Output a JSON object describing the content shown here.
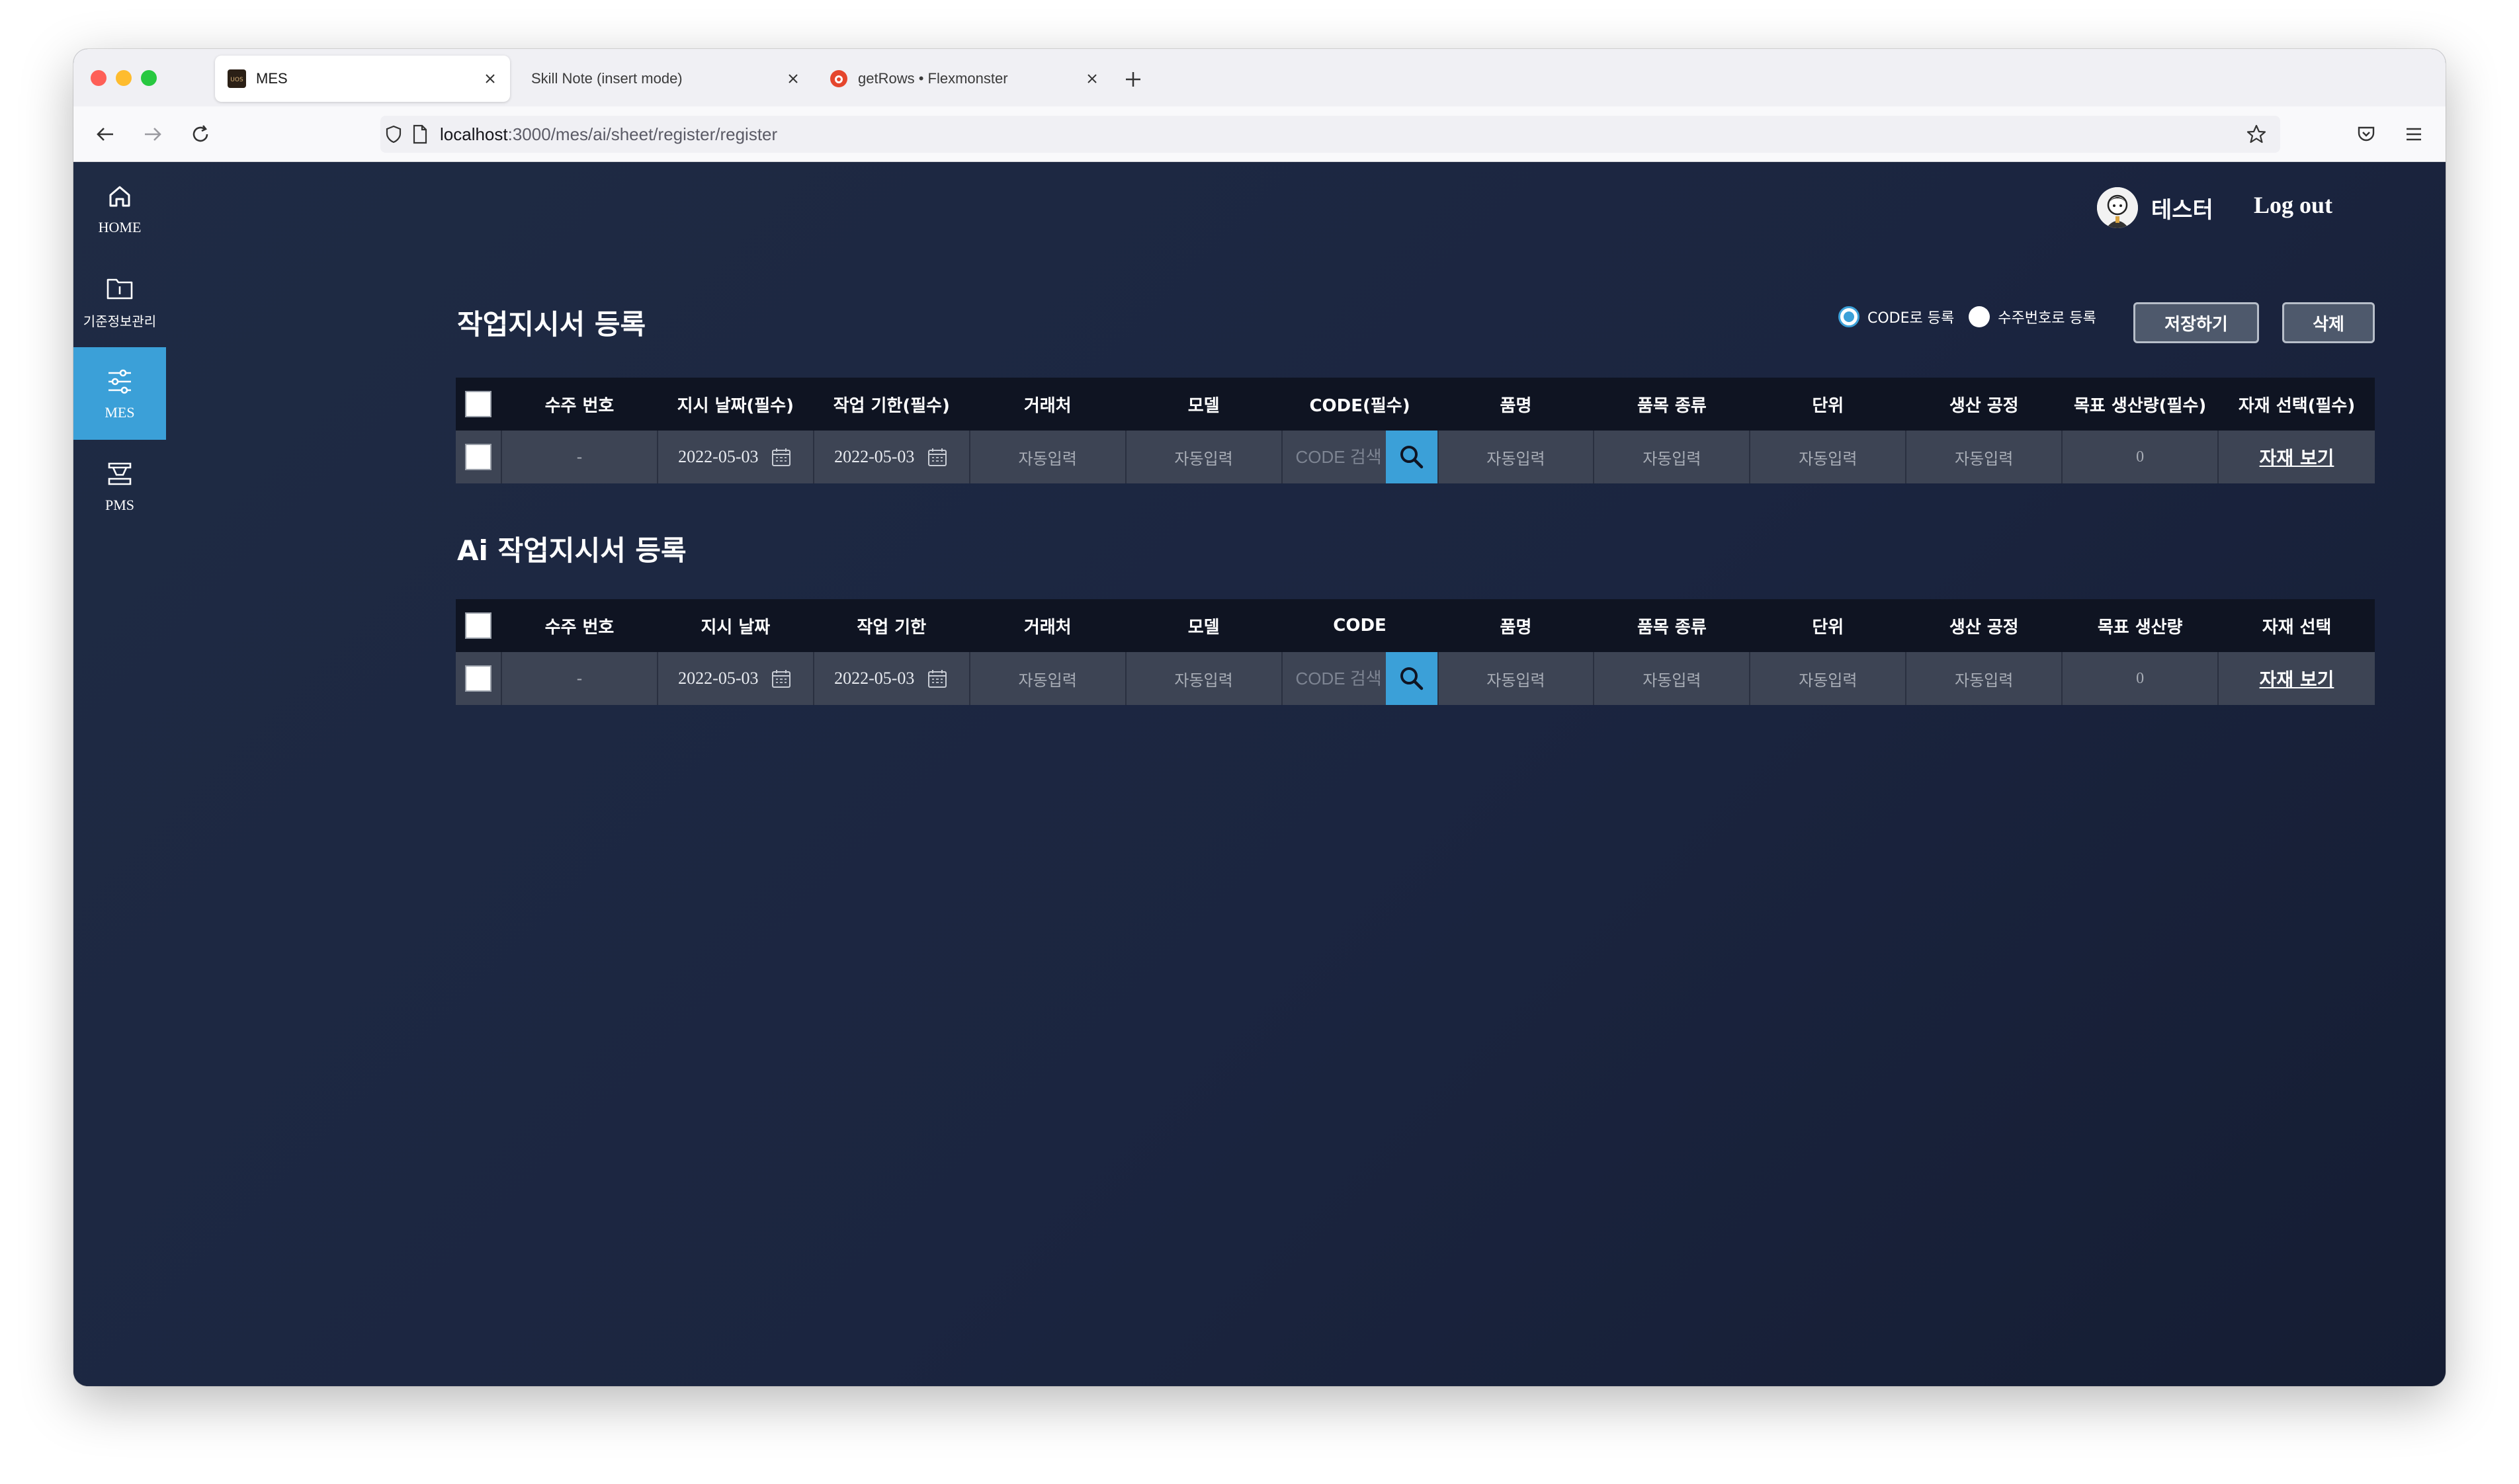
{
  "browser": {
    "tabs": [
      {
        "label": "MES",
        "active": true
      },
      {
        "label": "Skill Note (insert mode)",
        "active": false
      },
      {
        "label": "getRows • Flexmonster",
        "active": false
      }
    ],
    "url_host": "localhost",
    "url_path": ":3000/mes/ai/sheet/register/register"
  },
  "sidebar": {
    "items": [
      {
        "label": "HOME",
        "icon": "home-icon",
        "active": false
      },
      {
        "label": "기준정보관리",
        "icon": "folder-info-icon",
        "active": false
      },
      {
        "label": "MES",
        "icon": "sliders-icon",
        "active": true
      },
      {
        "label": "PMS",
        "icon": "machine-icon",
        "active": false
      }
    ]
  },
  "header": {
    "user_name": "테스터",
    "logout_label": "Log out"
  },
  "register_options": {
    "code_label": "CODE로 등록",
    "order_label": "수주번호로 등록",
    "selected": "code"
  },
  "actions": {
    "save_label": "저장하기",
    "delete_label": "삭제"
  },
  "colors": {
    "accent": "#3ba0d8",
    "background": "#1e2940",
    "table_header": "#0f1422",
    "table_row": "#3d4454"
  },
  "section1": {
    "title": "작업지시서 등록",
    "headers": [
      "수주 번호",
      "지시 날짜(필수)",
      "작업 기한(필수)",
      "거래처",
      "모델",
      "CODE(필수)",
      "품명",
      "품목 종류",
      "단위",
      "생산 공정",
      "목표 생산량(필수)",
      "자재 선택(필수)"
    ],
    "row": {
      "order_no": "-",
      "instruction_date": "2022-05-03",
      "deadline": "2022-05-03",
      "customer": "자동입력",
      "model": "자동입력",
      "code_placeholder": "CODE 검색",
      "product_name": "자동입력",
      "product_type": "자동입력",
      "unit": "자동입력",
      "process": "자동입력",
      "target_qty": "0",
      "material_link": "자재 보기"
    }
  },
  "section2": {
    "title": "Ai 작업지시서 등록",
    "headers": [
      "수주 번호",
      "지시 날짜",
      "작업 기한",
      "거래처",
      "모델",
      "CODE",
      "품명",
      "품목 종류",
      "단위",
      "생산 공정",
      "목표 생산량",
      "자재 선택"
    ],
    "row": {
      "order_no": "-",
      "instruction_date": "2022-05-03",
      "deadline": "2022-05-03",
      "customer": "자동입력",
      "model": "자동입력",
      "code_placeholder": "CODE 검색",
      "product_name": "자동입력",
      "product_type": "자동입력",
      "unit": "자동입력",
      "process": "자동입력",
      "target_qty": "0",
      "material_link": "자재 보기"
    }
  }
}
